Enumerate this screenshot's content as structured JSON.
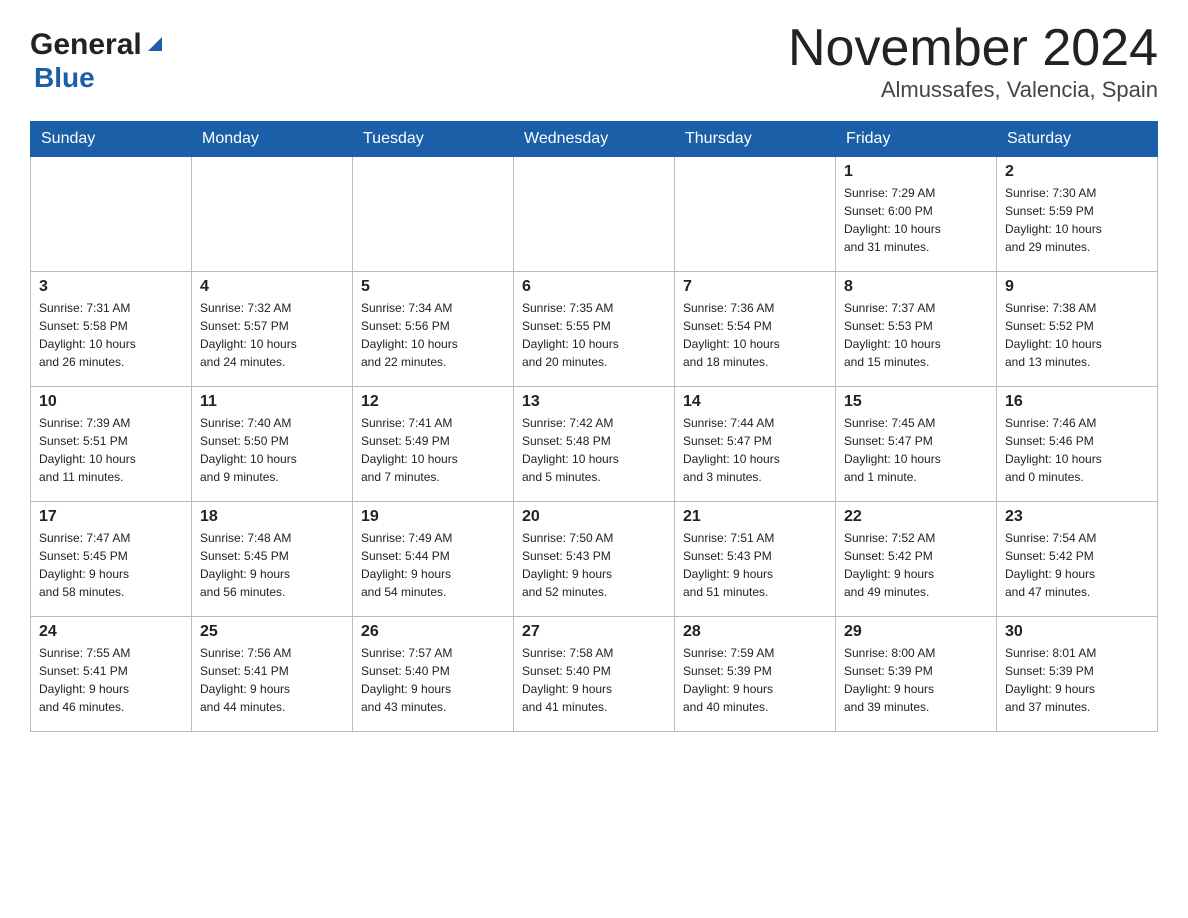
{
  "header": {
    "logo_general": "General",
    "logo_blue": "Blue",
    "title": "November 2024",
    "subtitle": "Almussafes, Valencia, Spain"
  },
  "weekdays": [
    "Sunday",
    "Monday",
    "Tuesday",
    "Wednesday",
    "Thursday",
    "Friday",
    "Saturday"
  ],
  "weeks": [
    [
      {
        "day": "",
        "info": ""
      },
      {
        "day": "",
        "info": ""
      },
      {
        "day": "",
        "info": ""
      },
      {
        "day": "",
        "info": ""
      },
      {
        "day": "",
        "info": ""
      },
      {
        "day": "1",
        "info": "Sunrise: 7:29 AM\nSunset: 6:00 PM\nDaylight: 10 hours\nand 31 minutes."
      },
      {
        "day": "2",
        "info": "Sunrise: 7:30 AM\nSunset: 5:59 PM\nDaylight: 10 hours\nand 29 minutes."
      }
    ],
    [
      {
        "day": "3",
        "info": "Sunrise: 7:31 AM\nSunset: 5:58 PM\nDaylight: 10 hours\nand 26 minutes."
      },
      {
        "day": "4",
        "info": "Sunrise: 7:32 AM\nSunset: 5:57 PM\nDaylight: 10 hours\nand 24 minutes."
      },
      {
        "day": "5",
        "info": "Sunrise: 7:34 AM\nSunset: 5:56 PM\nDaylight: 10 hours\nand 22 minutes."
      },
      {
        "day": "6",
        "info": "Sunrise: 7:35 AM\nSunset: 5:55 PM\nDaylight: 10 hours\nand 20 minutes."
      },
      {
        "day": "7",
        "info": "Sunrise: 7:36 AM\nSunset: 5:54 PM\nDaylight: 10 hours\nand 18 minutes."
      },
      {
        "day": "8",
        "info": "Sunrise: 7:37 AM\nSunset: 5:53 PM\nDaylight: 10 hours\nand 15 minutes."
      },
      {
        "day": "9",
        "info": "Sunrise: 7:38 AM\nSunset: 5:52 PM\nDaylight: 10 hours\nand 13 minutes."
      }
    ],
    [
      {
        "day": "10",
        "info": "Sunrise: 7:39 AM\nSunset: 5:51 PM\nDaylight: 10 hours\nand 11 minutes."
      },
      {
        "day": "11",
        "info": "Sunrise: 7:40 AM\nSunset: 5:50 PM\nDaylight: 10 hours\nand 9 minutes."
      },
      {
        "day": "12",
        "info": "Sunrise: 7:41 AM\nSunset: 5:49 PM\nDaylight: 10 hours\nand 7 minutes."
      },
      {
        "day": "13",
        "info": "Sunrise: 7:42 AM\nSunset: 5:48 PM\nDaylight: 10 hours\nand 5 minutes."
      },
      {
        "day": "14",
        "info": "Sunrise: 7:44 AM\nSunset: 5:47 PM\nDaylight: 10 hours\nand 3 minutes."
      },
      {
        "day": "15",
        "info": "Sunrise: 7:45 AM\nSunset: 5:47 PM\nDaylight: 10 hours\nand 1 minute."
      },
      {
        "day": "16",
        "info": "Sunrise: 7:46 AM\nSunset: 5:46 PM\nDaylight: 10 hours\nand 0 minutes."
      }
    ],
    [
      {
        "day": "17",
        "info": "Sunrise: 7:47 AM\nSunset: 5:45 PM\nDaylight: 9 hours\nand 58 minutes."
      },
      {
        "day": "18",
        "info": "Sunrise: 7:48 AM\nSunset: 5:45 PM\nDaylight: 9 hours\nand 56 minutes."
      },
      {
        "day": "19",
        "info": "Sunrise: 7:49 AM\nSunset: 5:44 PM\nDaylight: 9 hours\nand 54 minutes."
      },
      {
        "day": "20",
        "info": "Sunrise: 7:50 AM\nSunset: 5:43 PM\nDaylight: 9 hours\nand 52 minutes."
      },
      {
        "day": "21",
        "info": "Sunrise: 7:51 AM\nSunset: 5:43 PM\nDaylight: 9 hours\nand 51 minutes."
      },
      {
        "day": "22",
        "info": "Sunrise: 7:52 AM\nSunset: 5:42 PM\nDaylight: 9 hours\nand 49 minutes."
      },
      {
        "day": "23",
        "info": "Sunrise: 7:54 AM\nSunset: 5:42 PM\nDaylight: 9 hours\nand 47 minutes."
      }
    ],
    [
      {
        "day": "24",
        "info": "Sunrise: 7:55 AM\nSunset: 5:41 PM\nDaylight: 9 hours\nand 46 minutes."
      },
      {
        "day": "25",
        "info": "Sunrise: 7:56 AM\nSunset: 5:41 PM\nDaylight: 9 hours\nand 44 minutes."
      },
      {
        "day": "26",
        "info": "Sunrise: 7:57 AM\nSunset: 5:40 PM\nDaylight: 9 hours\nand 43 minutes."
      },
      {
        "day": "27",
        "info": "Sunrise: 7:58 AM\nSunset: 5:40 PM\nDaylight: 9 hours\nand 41 minutes."
      },
      {
        "day": "28",
        "info": "Sunrise: 7:59 AM\nSunset: 5:39 PM\nDaylight: 9 hours\nand 40 minutes."
      },
      {
        "day": "29",
        "info": "Sunrise: 8:00 AM\nSunset: 5:39 PM\nDaylight: 9 hours\nand 39 minutes."
      },
      {
        "day": "30",
        "info": "Sunrise: 8:01 AM\nSunset: 5:39 PM\nDaylight: 9 hours\nand 37 minutes."
      }
    ]
  ]
}
